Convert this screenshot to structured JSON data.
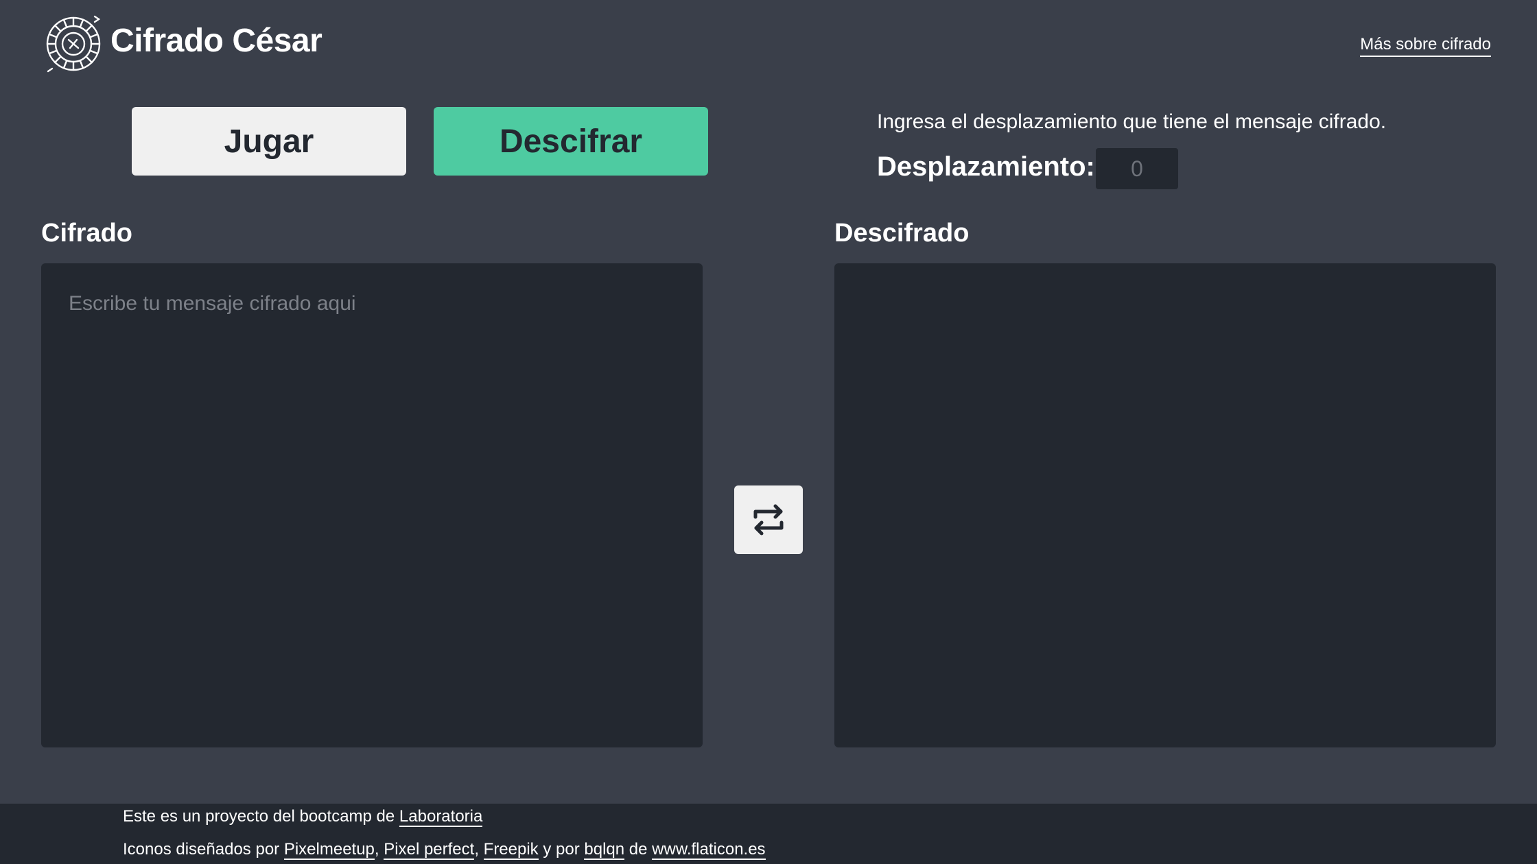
{
  "header": {
    "logo_icon": "caesar-cipher-wheel-icon",
    "title": "Cifrado César",
    "more_link": "Más sobre cifrado"
  },
  "modes": {
    "play_label": "Jugar",
    "decipher_label": "Descifrar",
    "active": "Descifrar"
  },
  "shift": {
    "instruction": "Ingresa el desplazamiento que tiene el mensaje cifrado.",
    "label": "Desplazamiento:",
    "placeholder": "0",
    "value": ""
  },
  "panels": {
    "ciphered": {
      "label": "Cifrado",
      "placeholder": "Escribe tu mensaje cifrado aqui",
      "value": ""
    },
    "deciphered": {
      "label": "Descifrado",
      "value": ""
    },
    "swap_icon": "swap-arrows-icon"
  },
  "footer": {
    "line1_prefix": "Este es un proyecto del bootcamp de ",
    "line1_link": "Laboratoria",
    "line2_prefix": "Iconos diseñados por ",
    "credit_1": "Pixelmeetup",
    "sep_1": ", ",
    "credit_2": "Pixel perfect",
    "sep_2": ", ",
    "credit_3": "Freepik",
    "sep_3": " y por ",
    "credit_4": "bqlqn",
    "sep_4": " de ",
    "site_link": "www.flaticon.es"
  },
  "colors": {
    "background": "#3a3f4a",
    "panel": "#232830",
    "accent": "#4ecba1",
    "button_light": "#f0f0f0"
  }
}
